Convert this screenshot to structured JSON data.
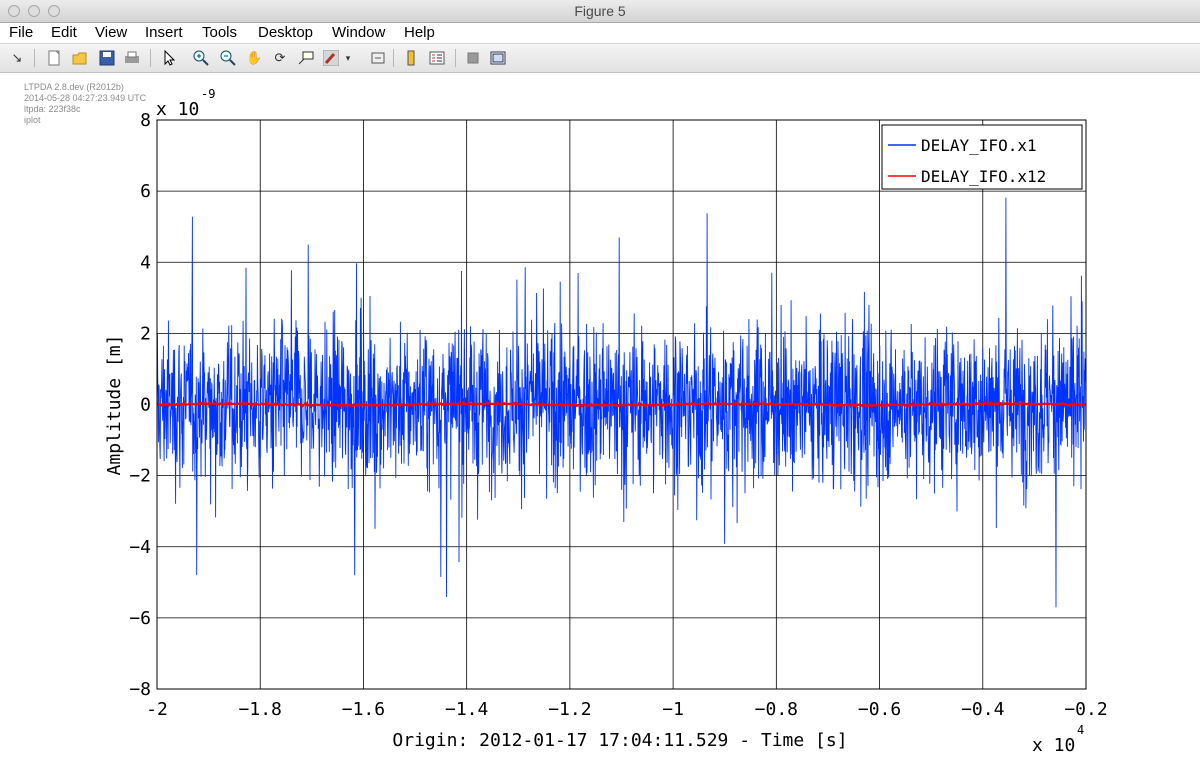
{
  "window": {
    "title": "Figure 5"
  },
  "menu": [
    "File",
    "Edit",
    "View",
    "Insert",
    "Tools",
    "Desktop",
    "Window",
    "Help"
  ],
  "toolbar": {
    "icons": [
      "dock-arrow-icon",
      "new-figure-icon",
      "open-file-icon",
      "save-icon",
      "print-icon",
      "pointer-icon",
      "zoom-in-icon",
      "zoom-out-icon",
      "pan-hand-icon",
      "rotate-3d-icon",
      "data-cursor-icon",
      "brush-icon",
      "brush-dropdown-icon",
      "link-plot-icon",
      "colorbar-icon",
      "legend-icon",
      "hide-plot-tools-icon",
      "show-plot-tools-icon"
    ]
  },
  "metadata_lines": [
    "LTPDA 2.8.dev (R2012b)",
    "2014-05-28 04:27:23.949 UTC",
    "ltpda: 223f38c",
    "iplot"
  ],
  "chart_data": {
    "type": "line",
    "ylabel": "Amplitude  [m]",
    "xlabel": "Origin: 2012-01-17 17:04:11.529 - Time  [s]",
    "x_multiplier": "x 10",
    "x_exponent": "4",
    "y_multiplier": "x 10",
    "y_exponent": "-9",
    "xlim": [
      -2,
      -0.2
    ],
    "ylim": [
      -8,
      8
    ],
    "x_ticks": [
      -2,
      -1.8,
      -1.6,
      -1.4,
      -1.2,
      -1,
      -0.8,
      -0.6,
      -0.4,
      -0.2
    ],
    "x_tick_labels": [
      "-2",
      "−1.8",
      "−1.6",
      "−1.4",
      "−1.2",
      "−1",
      "−0.8",
      "−0.6",
      "−0.4",
      "−0.2"
    ],
    "y_ticks": [
      8,
      6,
      4,
      2,
      0,
      -2,
      -4,
      -6,
      -8
    ],
    "y_tick_labels": [
      "8",
      "6",
      "4",
      "2",
      "0",
      "−2",
      "−4",
      "−6",
      "−8"
    ],
    "grid": true,
    "legend_position": "top-right",
    "series": [
      {
        "name": "DELAY_IFO.x1",
        "color": "#0033ff",
        "description_stats": {
          "typical_abs": 2.5,
          "max": 6.1,
          "min": -7.1
        }
      },
      {
        "name": "DELAY_IFO.x12",
        "color": "#ff0000",
        "description_stats": {
          "typical_abs": 0.05,
          "max": 0.1,
          "min": -0.1
        }
      }
    ]
  }
}
